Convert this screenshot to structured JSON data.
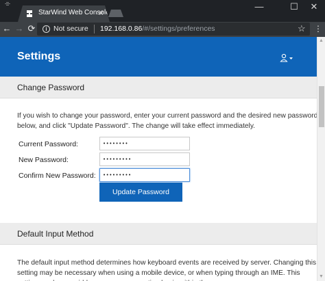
{
  "browser": {
    "tab_title": "StarWind Web Console",
    "tab_close": "×",
    "menu_glyph": "⌯",
    "nav": {
      "back": "←",
      "forward": "→",
      "reload": "⟳"
    },
    "security": {
      "info_glyph": "i",
      "label": "Not secure"
    },
    "url": {
      "host": "192.168.0.86",
      "path": "/#/settings/preferences"
    },
    "star": "☆",
    "menu": "⋮",
    "window_controls": {
      "minimize": "—",
      "maximize": "☐",
      "close": "✕"
    }
  },
  "header": {
    "title": "Settings",
    "user_icon": "user-icon",
    "dropdown_icon": "caret-down-icon"
  },
  "change_password": {
    "heading": "Change Password",
    "intro": "If you wish to change your password, enter your current password and the desired new password below, and click \"Update Password\". The change will take effect immediately.",
    "fields": [
      {
        "label": "Current Password:",
        "value": "••••••••"
      },
      {
        "label": "New Password:",
        "value": "•••••••••"
      },
      {
        "label": "Confirm New Password:",
        "value": "•••••••••"
      }
    ],
    "button": "Update Password"
  },
  "input_method": {
    "heading": "Default Input Method",
    "intro": "The default input method determines how keyboard events are received by server. Changing this setting may be necessary when using a mobile device, or when typing through an IME. This setting can be overridden on a per-connection basis within the menu."
  },
  "colors": {
    "accent": "#0f64b8",
    "chrome_dark": "#1f2226",
    "chrome_toolbar": "#3d4145"
  }
}
